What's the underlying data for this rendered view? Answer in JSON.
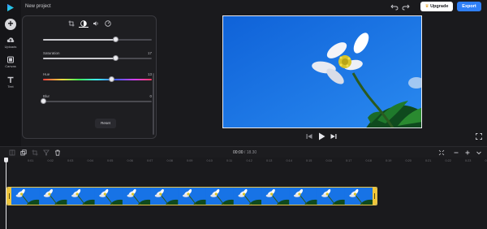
{
  "app": {
    "project_title": "New project"
  },
  "left_rail": {
    "add_label": "+",
    "items": [
      {
        "label": "Uploads",
        "icon": "cloud-upload-icon"
      },
      {
        "label": "Canvas",
        "icon": "canvas-icon"
      },
      {
        "label": "Text",
        "icon": "text-icon"
      }
    ]
  },
  "header": {
    "upgrade_label": "Upgrade",
    "upgrade_icon": "crown-icon",
    "export_label": "Export"
  },
  "adjust_panel": {
    "tabs": [
      {
        "icon": "crop-icon",
        "active": false
      },
      {
        "icon": "contrast-icon",
        "active": true
      },
      {
        "icon": "audio-icon",
        "active": false
      },
      {
        "icon": "speed-icon",
        "active": false
      }
    ],
    "sliders": [
      {
        "name": "",
        "value": "",
        "fraction": 0.67
      },
      {
        "name": "Saturation",
        "value": "17",
        "fraction": 0.67
      },
      {
        "name": "Hue",
        "value": "13",
        "fraction": 0.63
      },
      {
        "name": "Blur",
        "value": "0",
        "fraction": 0.0
      }
    ],
    "reset_label": "Reset"
  },
  "player": {
    "current_time": "00:00",
    "separator": "/",
    "duration": "18.30"
  },
  "timeline": {
    "ruler_labels": [
      "0:01",
      "0:02",
      "0:03",
      "0:04",
      "0:05",
      "0:06",
      "0:07",
      "0:08",
      "0:09",
      "0:10",
      "0:11",
      "0:12",
      "0:13",
      "0:14",
      "0:15",
      "0:16",
      "0:17",
      "0:18",
      "0:19",
      "0:20",
      "0:21",
      "0:22",
      "0:23",
      "0:24",
      "0:25"
    ],
    "clip_thumbnail_count": 13
  },
  "colors": {
    "accent": "#2f7ff6",
    "background": "#1a1a1d",
    "clip_border": "#e6c34a",
    "sky": "#1773e6"
  }
}
